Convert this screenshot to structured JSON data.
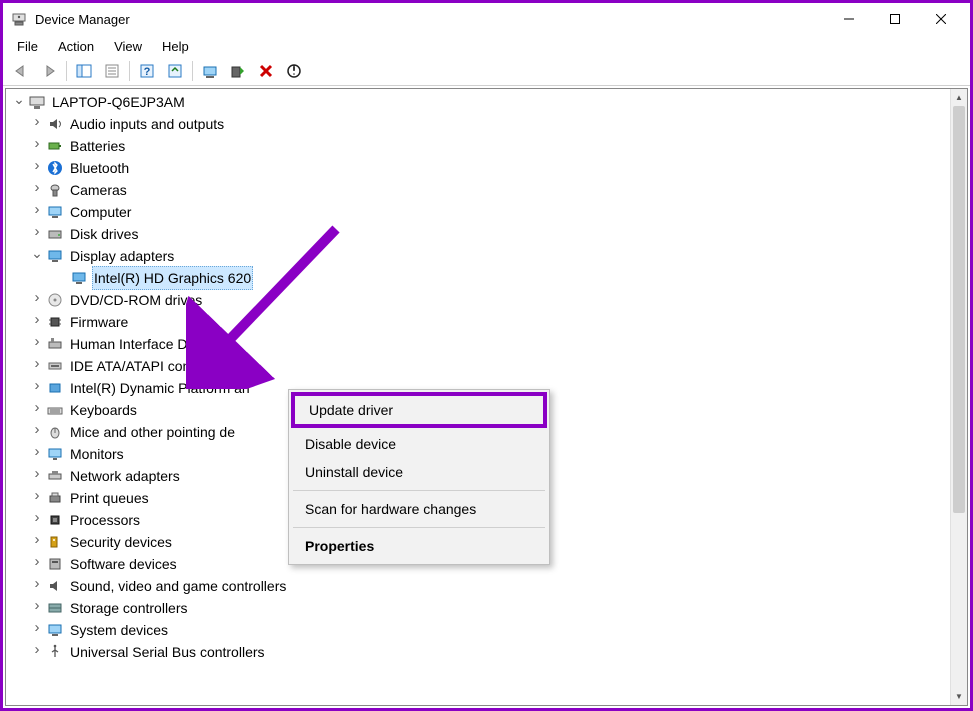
{
  "window": {
    "title": "Device Manager"
  },
  "menu": {
    "file": "File",
    "action": "Action",
    "view": "View",
    "help": "Help"
  },
  "tree": {
    "root": "LAPTOP-Q6EJP3AM",
    "audio": "Audio inputs and outputs",
    "batteries": "Batteries",
    "bluetooth": "Bluetooth",
    "cameras": "Cameras",
    "computer": "Computer",
    "diskdrives": "Disk drives",
    "display": "Display adapters",
    "display_child": "Intel(R) HD Graphics 620",
    "dvd": "DVD/CD-ROM drives",
    "firmware": "Firmware",
    "hid": "Human Interface Devices",
    "ide": "IDE ATA/ATAPI controllers",
    "inteldyn": "Intel(R) Dynamic Platform an",
    "keyboards": "Keyboards",
    "mice": "Mice and other pointing de",
    "monitors": "Monitors",
    "network": "Network adapters",
    "printq": "Print queues",
    "processors": "Processors",
    "security": "Security devices",
    "software": "Software devices",
    "sound": "Sound, video and game controllers",
    "storage": "Storage controllers",
    "system": "System devices",
    "usb": "Universal Serial Bus controllers"
  },
  "context_menu": {
    "update": "Update driver",
    "disable": "Disable device",
    "uninstall": "Uninstall device",
    "scan": "Scan for hardware changes",
    "properties": "Properties"
  }
}
